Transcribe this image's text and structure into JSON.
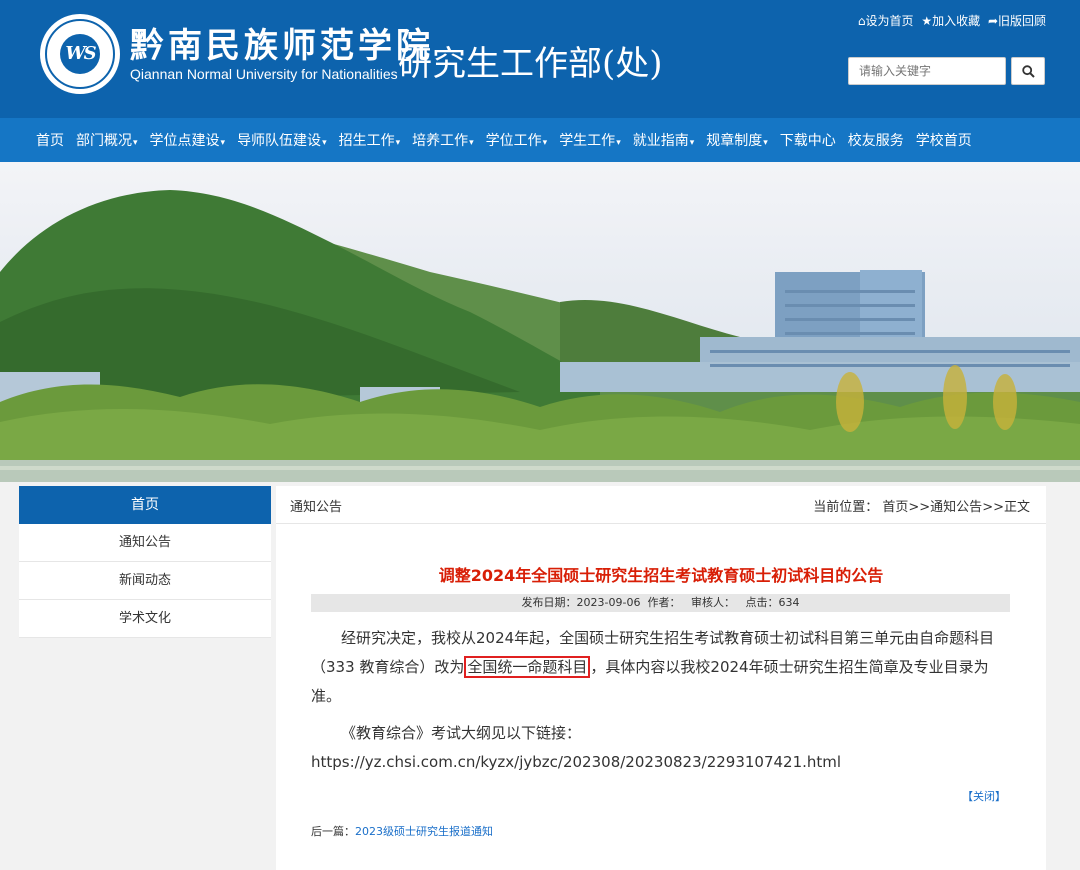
{
  "header": {
    "logo_text": "WS",
    "school_cn": "黔南民族师范学院",
    "school_en": "Qiannan Normal University for Nationalities",
    "dept_name": "研究生工作部(处)",
    "top_links": {
      "set_home": "⌂设为首页",
      "add_fav": "★加入收藏",
      "old_version": "➦旧版回顾"
    },
    "search": {
      "placeholder": "请输入关键字",
      "value": ""
    }
  },
  "nav": {
    "items": [
      {
        "label": "首页",
        "dropdown": false
      },
      {
        "label": "部门概况",
        "dropdown": true
      },
      {
        "label": "学位点建设",
        "dropdown": true
      },
      {
        "label": "导师队伍建设",
        "dropdown": true
      },
      {
        "label": "招生工作",
        "dropdown": true
      },
      {
        "label": "培养工作",
        "dropdown": true
      },
      {
        "label": "学位工作",
        "dropdown": true
      },
      {
        "label": "学生工作",
        "dropdown": true
      },
      {
        "label": "就业指南",
        "dropdown": true
      },
      {
        "label": "规章制度",
        "dropdown": true
      },
      {
        "label": "下载中心",
        "dropdown": false
      },
      {
        "label": "校友服务",
        "dropdown": false
      },
      {
        "label": "学校首页",
        "dropdown": false
      }
    ],
    "caret": "▾"
  },
  "sidebar": {
    "header": "首页",
    "items": [
      {
        "label": "通知公告"
      },
      {
        "label": "新闻动态"
      },
      {
        "label": "学术文化"
      }
    ]
  },
  "main": {
    "section_title": "通知公告",
    "breadcrumb": {
      "prefix": "当前位置：",
      "home": "首页",
      "sep1": ">>",
      "section": "通知公告",
      "sep2": ">>",
      "current": "正文"
    },
    "article": {
      "title": "调整2024年全国硕士研究生招生考试教育硕士初试科目的公告",
      "meta": {
        "date_label": "发布日期：",
        "date": "2023-09-06",
        "author_label": "作者：",
        "reviewer_label": "审核人：",
        "views_label": "点击：",
        "views": "634"
      },
      "para1_before": "经研究决定，我校从2024年起，全国硕士研究生招生考试教育硕士初试科目第三单元由自命题科目（333 教育综合）改为",
      "para1_highlight": "全国统一命题科目",
      "para1_after": "，具体内容以我校2024年硕士研究生招生简章及专业目录为准。",
      "para2": "《教育综合》考试大纲见以下链接：",
      "link": "https://yz.chsi.com.cn/kyzx/jybzc/202308/20230823/2293107421.html"
    },
    "close_label": "【关闭】",
    "prev": {
      "label": "后一篇：",
      "title": "2023级硕士研究生报道通知"
    }
  },
  "colors": {
    "header_bg": "#0d63ad",
    "nav_bg": "#1576c5",
    "title_red": "#d81e06",
    "highlight_box": "#e02020",
    "link_blue": "#1a6fc9"
  }
}
